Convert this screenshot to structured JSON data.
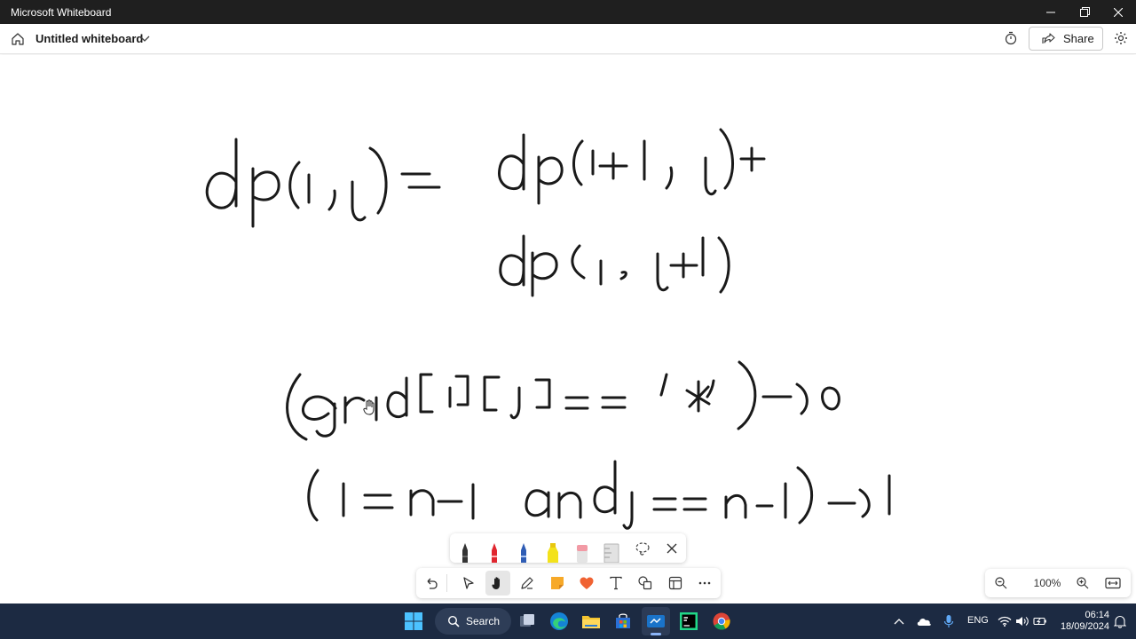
{
  "window": {
    "title": "Microsoft Whiteboard"
  },
  "header": {
    "board_name": "Untitled whiteboard",
    "share_label": "Share"
  },
  "canvas": {
    "ink_lines": [
      "dp(i,j)=  dp(i+1, j)+",
      "dp(i, j+1)",
      "(grid[i][j]== '*' )->0",
      "(i=n-1  andj==n-1)->1"
    ]
  },
  "pen_tray": {
    "pens": [
      {
        "name": "black-pen",
        "color": "#222222"
      },
      {
        "name": "red-pen",
        "color": "#e0262f"
      },
      {
        "name": "blue-pen",
        "color": "#2f5db5"
      },
      {
        "name": "yellow-highlighter",
        "color": "#f3e21b"
      },
      {
        "name": "eraser",
        "color": "#f29aa5"
      },
      {
        "name": "ruler",
        "color": "#c8c8c8"
      }
    ]
  },
  "toolbar": {
    "tools": [
      "undo-icon",
      "select-icon",
      "hand-icon",
      "pen-icon",
      "sticky-note-icon",
      "reaction-icon",
      "text-icon",
      "shapes-icon",
      "templates-icon",
      "more-icon"
    ],
    "active_tool": "hand-icon"
  },
  "zoom": {
    "level": "100%"
  },
  "taskbar": {
    "search_label": "Search",
    "language": "ENG",
    "time": "06:14",
    "date": "18/09/2024"
  },
  "colors": {
    "accent": "#e27a1b",
    "taskbar": "#1c2a42",
    "titlebar": "#1f1f1f"
  }
}
